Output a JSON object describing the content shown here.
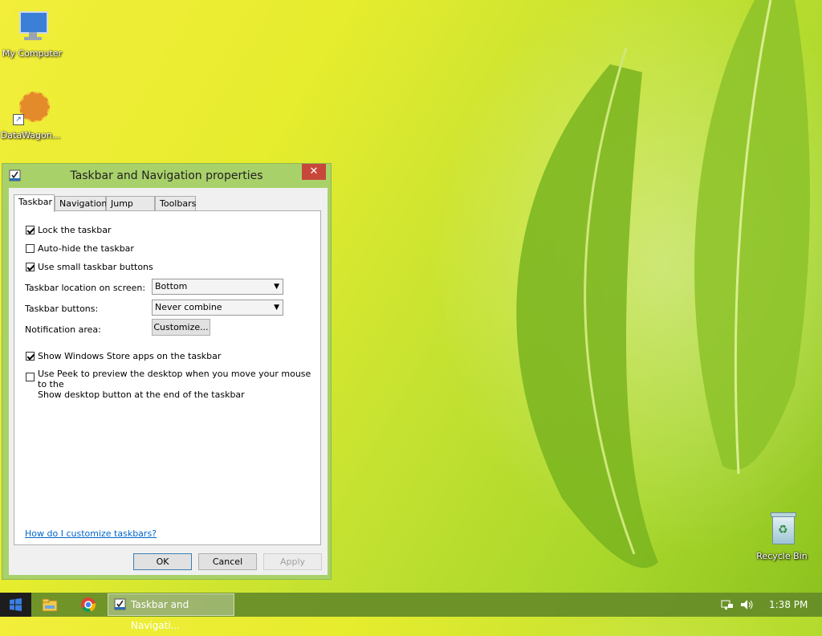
{
  "desktop": {
    "icons": [
      {
        "label": "My Computer"
      },
      {
        "label": "DataWagon..."
      },
      {
        "label": "Recycle Bin"
      }
    ]
  },
  "dialog": {
    "title": "Taskbar and Navigation properties",
    "close_glyph": "✕",
    "tabs": [
      {
        "label": "Taskbar",
        "active": true
      },
      {
        "label": "Navigation"
      },
      {
        "label": "Jump Lists"
      },
      {
        "label": "Toolbars"
      }
    ],
    "checkboxes": {
      "lock": {
        "label": "Lock the taskbar",
        "checked": true
      },
      "autohide": {
        "label": "Auto-hide the taskbar",
        "checked": false
      },
      "small": {
        "label": "Use small taskbar buttons",
        "checked": true
      },
      "store_apps": {
        "label": "Show Windows Store apps on the taskbar",
        "checked": true
      },
      "peek_line1": "Use Peek to preview the desktop when you move your mouse to the",
      "peek_line2": "Show desktop button at the end of the taskbar",
      "peek_checked": false
    },
    "location_label": "Taskbar location on screen:",
    "location_value": "Bottom",
    "buttons_label": "Taskbar buttons:",
    "buttons_value": "Never combine",
    "notification_label": "Notification area:",
    "customize_label": "Customize...",
    "help_link": "How do I customize taskbars?",
    "ok_label": "OK",
    "cancel_label": "Cancel",
    "apply_label": "Apply"
  },
  "taskbar": {
    "task_label": "Taskbar and Navigati...",
    "clock": "1:38 PM"
  },
  "colors": {
    "accent": "#a9d16a",
    "close": "#c7483b",
    "link": "#0066cc"
  }
}
